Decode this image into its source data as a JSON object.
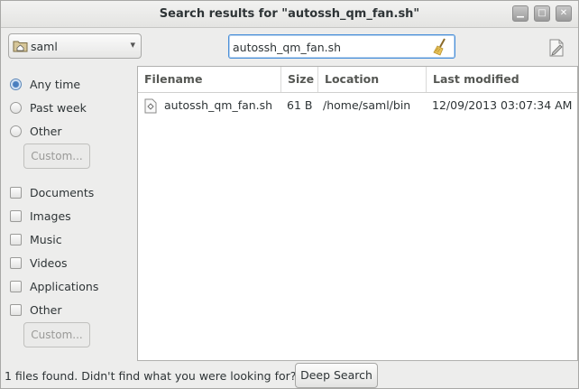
{
  "window": {
    "title": "Search results for \"autossh_qm_fan.sh\"",
    "minimize_glyph": "▁",
    "maximize_glyph": "□",
    "close_glyph": "✕"
  },
  "toolbar": {
    "location": "saml",
    "location_icon": "folder-home-icon",
    "dropdown_icon": "chevron-down-icon",
    "search_value": "autossh_qm_fan.sh",
    "clear_icon": "broom-icon",
    "extra_icon": "document-edit-icon"
  },
  "time_filters": [
    {
      "label": "Any time",
      "selected": true
    },
    {
      "label": "Past week",
      "selected": false
    },
    {
      "label": "Other",
      "selected": false
    }
  ],
  "time_custom_label": "Custom...",
  "type_filters": [
    {
      "label": "Documents",
      "checked": false
    },
    {
      "label": "Images",
      "checked": false
    },
    {
      "label": "Music",
      "checked": false
    },
    {
      "label": "Videos",
      "checked": false
    },
    {
      "label": "Applications",
      "checked": false
    },
    {
      "label": "Other",
      "checked": false
    }
  ],
  "type_custom_label": "Custom...",
  "table": {
    "columns": [
      "Filename",
      "Size",
      "Location",
      "Last modified"
    ],
    "rows": [
      {
        "filename": "autossh_qm_fan.sh",
        "size": "61 B",
        "location": "/home/saml/bin",
        "modified": "12/09/2013 03:07:34 AM",
        "icon": "script-file-icon"
      }
    ]
  },
  "status": {
    "text": "1 files found.  Didn't find what you were looking for?",
    "deep_search_label": "Deep Search"
  }
}
